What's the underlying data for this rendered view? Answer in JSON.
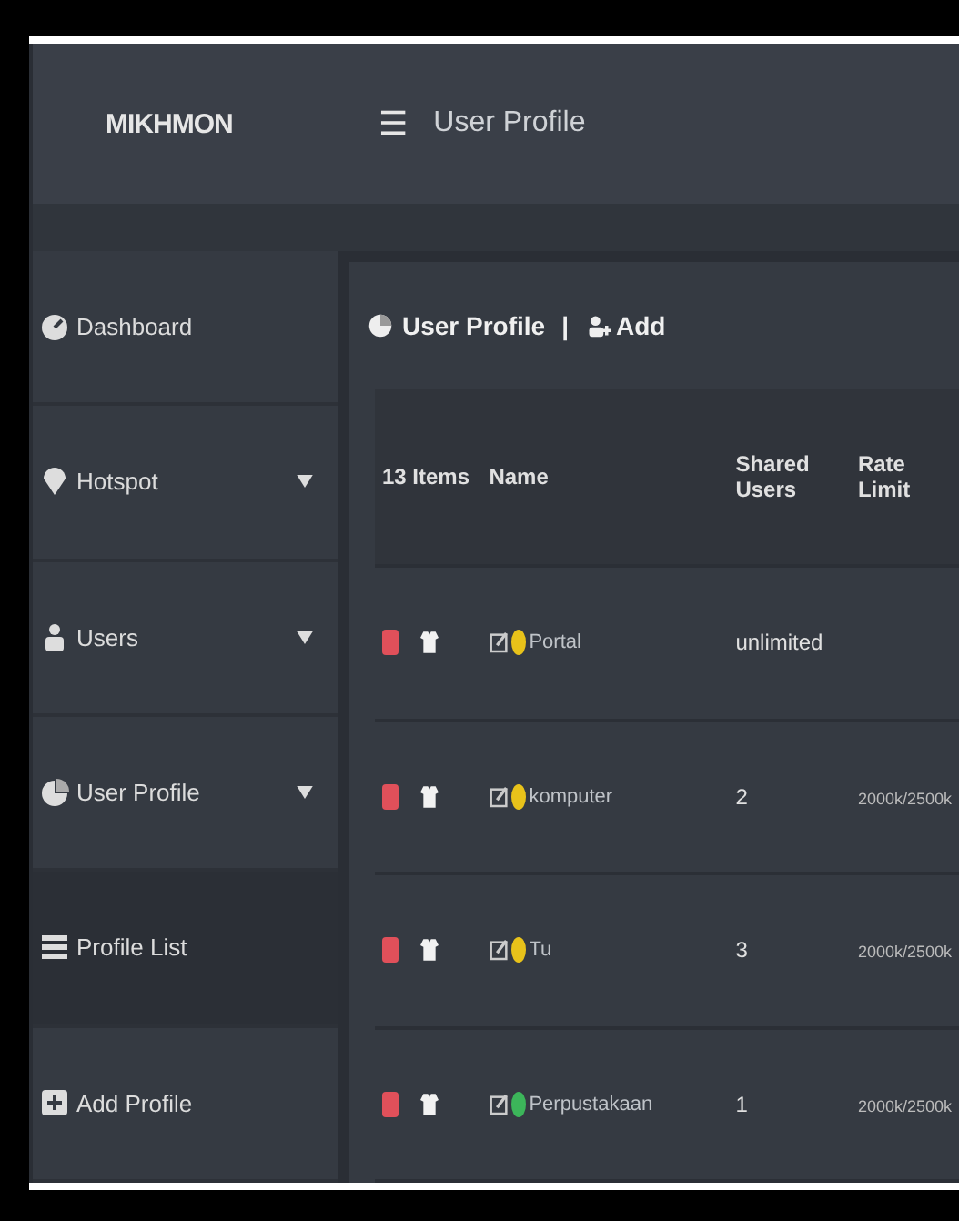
{
  "header": {
    "brand": "MIKHMON",
    "menu_icon": "☰",
    "title": "User Profile"
  },
  "sidebar": {
    "items": [
      {
        "label": "Dashboard",
        "caret": false,
        "selected": false
      },
      {
        "label": "Hotspot",
        "caret": true,
        "selected": false
      },
      {
        "label": "Users",
        "caret": true,
        "selected": false
      },
      {
        "label": "User Profile",
        "caret": true,
        "selected": false
      },
      {
        "label": "Profile List",
        "caret": false,
        "selected": true
      },
      {
        "label": "Add Profile",
        "caret": false,
        "selected": false
      }
    ]
  },
  "card": {
    "title": "User Profile",
    "separator": "|",
    "add_link": "Add"
  },
  "table": {
    "columns": [
      "13 Items",
      "Name",
      "Shared Users",
      "Rate Limit"
    ],
    "rows": [
      {
        "name": "Portal",
        "color": "#e8c21a",
        "shared_users": "unlimited"
      },
      {
        "name": "komputer",
        "color": "#e8c21a",
        "shared_users": "2",
        "rate_limit": "2000k/2500k"
      },
      {
        "name": "Tu",
        "color": "#e8c21a",
        "shared_users": "3",
        "rate_limit": "2000k/2500k"
      },
      {
        "name": "Perpustakaan",
        "color": "#3cb55a",
        "shared_users": "1",
        "rate_limit": "2000k/2500k"
      }
    ]
  }
}
